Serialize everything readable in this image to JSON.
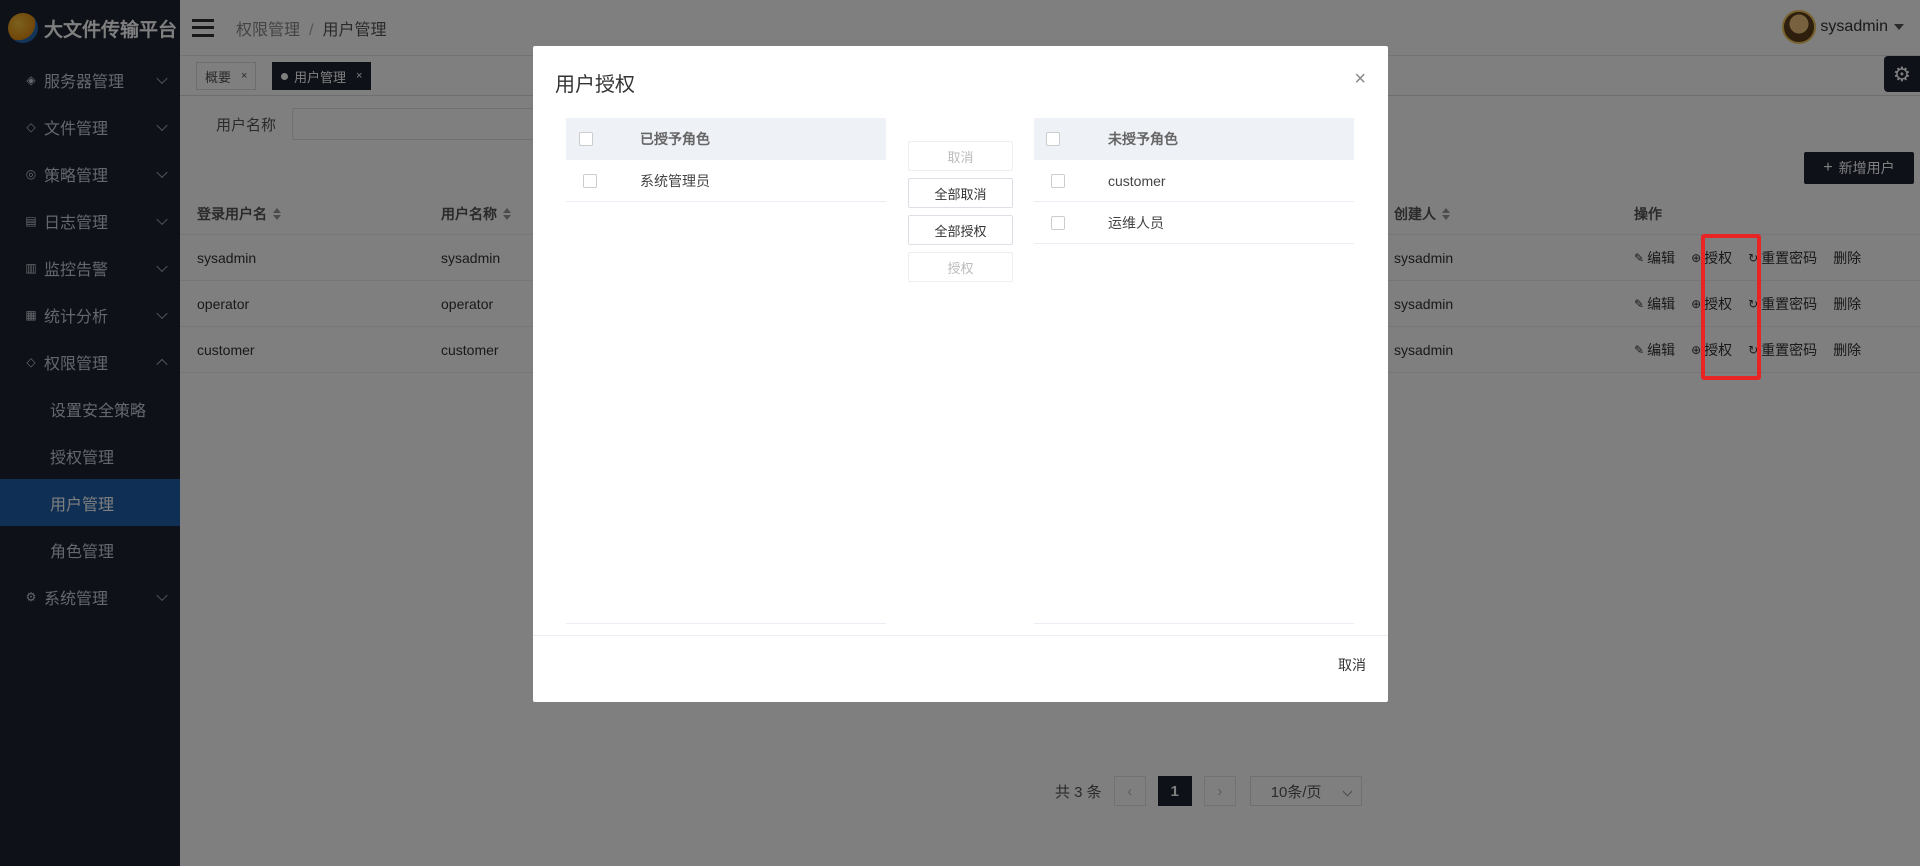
{
  "app": {
    "title": "大文件传输平台"
  },
  "sidebar": {
    "items": [
      {
        "label": "服务器管理",
        "icon": "server-icon"
      },
      {
        "label": "文件管理",
        "icon": "file-icon"
      },
      {
        "label": "策略管理",
        "icon": "policy-icon"
      },
      {
        "label": "日志管理",
        "icon": "log-icon"
      },
      {
        "label": "监控告警",
        "icon": "monitor-icon"
      },
      {
        "label": "统计分析",
        "icon": "stats-icon"
      },
      {
        "label": "权限管理",
        "icon": "permission-icon",
        "expanded": true
      },
      {
        "label": "系统管理",
        "icon": "system-icon"
      }
    ],
    "subitems": [
      {
        "label": "设置安全策略"
      },
      {
        "label": "授权管理"
      },
      {
        "label": "用户管理",
        "active": true
      },
      {
        "label": "角色管理"
      }
    ]
  },
  "header": {
    "breadcrumb": [
      "权限管理",
      "用户管理"
    ],
    "separator": "/",
    "username": "sysadmin"
  },
  "tabs": [
    {
      "label": "概要",
      "close": "×"
    },
    {
      "label": "用户管理",
      "close": "×",
      "active": true
    }
  ],
  "search": {
    "label": "用户名称",
    "placeholder": ""
  },
  "add_button": {
    "label": "新增用户",
    "icon": "plus-icon"
  },
  "table": {
    "columns": [
      "登录用户名",
      "用户名称",
      "创建人",
      "操作"
    ],
    "rows": [
      {
        "login": "sysadmin",
        "name": "sysadmin",
        "creator": "sysadmin"
      },
      {
        "login": "operator",
        "name": "operator",
        "creator": "sysadmin"
      },
      {
        "login": "customer",
        "name": "customer",
        "creator": "sysadmin"
      }
    ],
    "actions": {
      "edit": "编辑",
      "authorize": "授权",
      "reset": "重置密码",
      "delete": "删除"
    }
  },
  "pagination": {
    "total": "共 3 条",
    "current": "1",
    "page_size": "10条/页",
    "prev": "‹",
    "next": "›"
  },
  "modal": {
    "title": "用户授权",
    "close": "×",
    "left_panel": {
      "header": "已授予角色",
      "items": [
        "系统管理员"
      ]
    },
    "right_panel": {
      "header": "未授予角色",
      "items": [
        "customer",
        "运维人员"
      ]
    },
    "buttons": {
      "cancel": "取消",
      "cancel_all": "全部取消",
      "grant_all": "全部授权",
      "grant": "授权"
    },
    "footer_cancel": "取消"
  },
  "colors": {
    "sidebar_bg": "#1c2331",
    "active_item": "#1f5fa8",
    "highlight": "#e82424"
  }
}
